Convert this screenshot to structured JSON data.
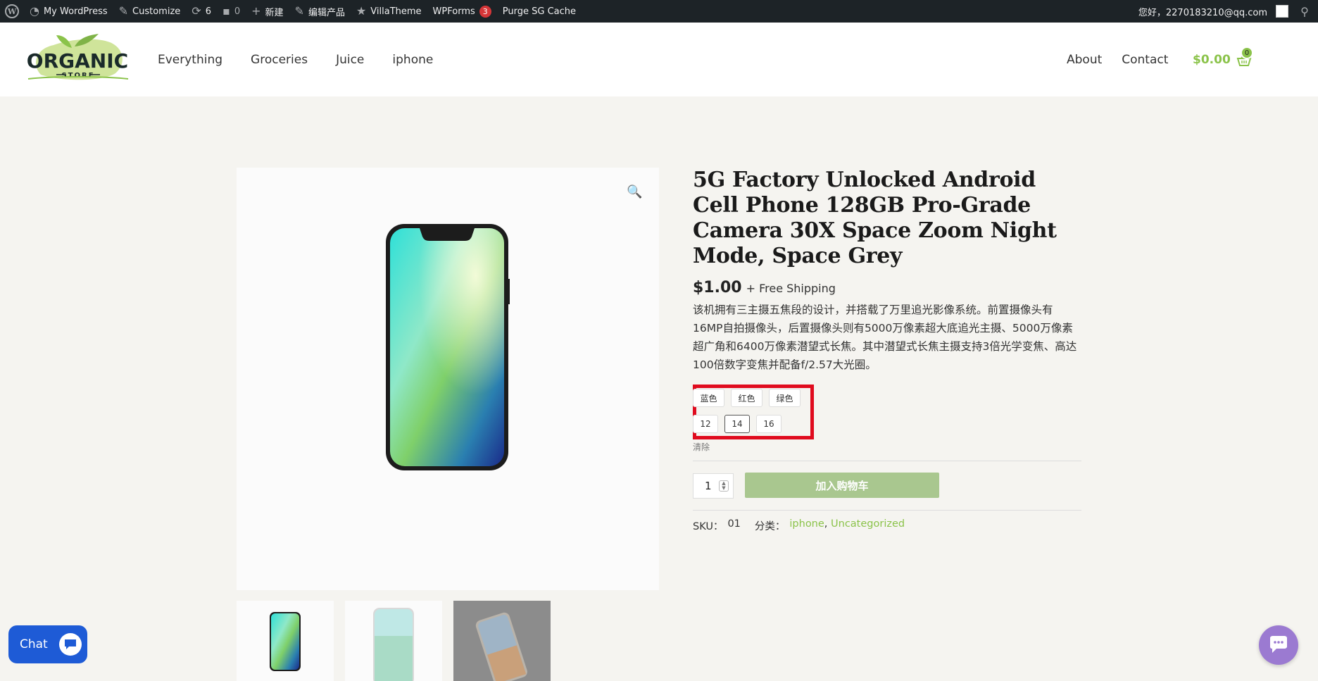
{
  "adminbar": {
    "site_name": "My WordPress",
    "customize": "Customize",
    "updates_count": "6",
    "comments_count": "0",
    "new": "新建",
    "edit_product": "编辑产品",
    "theme": "VillaTheme",
    "wpforms": "WPForms",
    "wpforms_badge": "3",
    "purge": "Purge SG Cache",
    "greeting": "您好，2270183210@qq.com"
  },
  "header": {
    "logo_line1": "ORGANIC",
    "logo_line2": "STORE",
    "nav": [
      "Everything",
      "Groceries",
      "Juice",
      "iphone"
    ],
    "nav_right": [
      "About",
      "Contact"
    ],
    "cart_total": "$0.00",
    "cart_count": "0"
  },
  "product": {
    "title": "5G Factory Unlocked Android Cell Phone 128GB Pro-Grade Camera 30X Space Zoom Night Mode, Space Grey",
    "price": "$1.00",
    "shipping": "+ Free Shipping",
    "description": "该机拥有三主摄五焦段的设计，并搭载了万里追光影像系统。前置摄像头有16MP自拍摄像头，后置摄像头则有5000万像素超大底追光主摄、5000万像素超广角和6400万像素潜望式长焦。其中潜望式长焦主摄支持3倍光学变焦、高达100倍数字变焦并配备f/2.57大光圈。",
    "colors": [
      "蓝色",
      "红色",
      "绿色"
    ],
    "sizes": [
      "12",
      "14",
      "16"
    ],
    "selected_size": "14",
    "reset_label": "清除",
    "quantity": "1",
    "add_to_cart": "加入购物车",
    "sku_label": "SKU：",
    "sku": "01",
    "category_label": "分类：",
    "categories": [
      "iphone",
      "Uncategorized"
    ]
  },
  "chat": {
    "label": "Chat"
  },
  "colors": {
    "accent": "#8bc34a",
    "adminbar": "#1d2327",
    "highlight": "#e00b1e",
    "chat": "#1e5bd6",
    "messenger": "#9b7ad1"
  }
}
